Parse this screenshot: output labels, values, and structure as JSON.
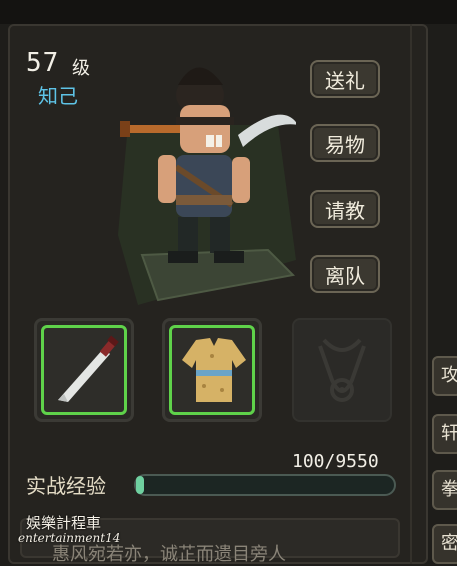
{
  "character": {
    "level": "57",
    "level_unit": "级",
    "relation": "知己"
  },
  "actions": [
    {
      "label": "送礼"
    },
    {
      "label": "易物"
    },
    {
      "label": "请教"
    },
    {
      "label": "离队"
    }
  ],
  "equipment": [
    {
      "name": "weapon-machete",
      "state": "equipped"
    },
    {
      "name": "armor-tunic",
      "state": "equipped"
    },
    {
      "name": "accessory-necklace",
      "state": "empty"
    }
  ],
  "experience": {
    "label": "实战经验",
    "value": "100/9550",
    "progress": 0.0105
  },
  "description": {
    "text": "惠风宛若亦，诚芷而遗目旁人"
  },
  "side_tabs": [
    {
      "label": "攻"
    },
    {
      "label": "轩"
    },
    {
      "label": "拳"
    },
    {
      "label": "密"
    }
  ],
  "watermark": {
    "cn": "娛樂計程車",
    "en": "entertainment14"
  },
  "colors": {
    "relation": "#5ec3e6",
    "equipped_border": "#5fd24a",
    "exp_fill": "#6fd0a0",
    "button_bg": "#3b3830"
  }
}
